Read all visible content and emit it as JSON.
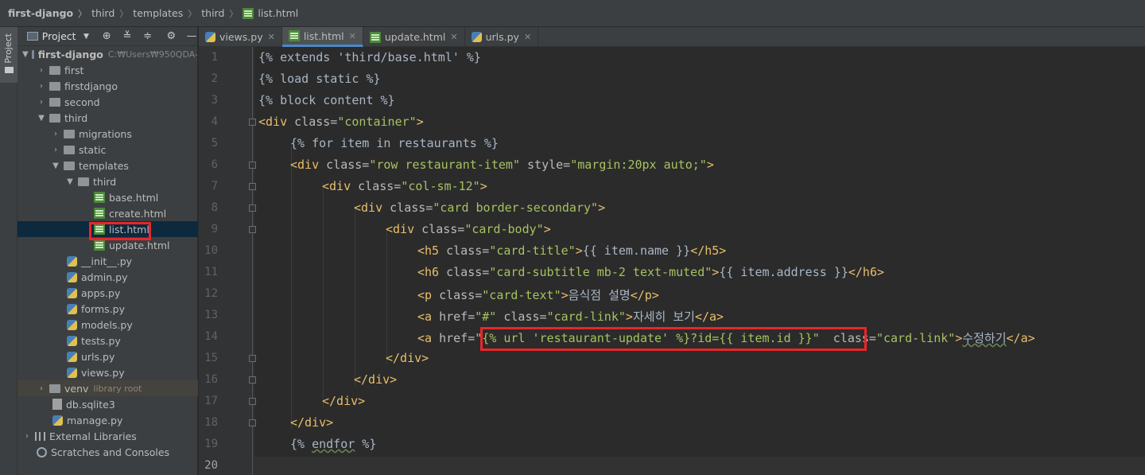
{
  "breadcrumb": {
    "items": [
      "first-django",
      "third",
      "templates",
      "third",
      "list.html"
    ]
  },
  "side_stripe": {
    "tab_label": "Project"
  },
  "project_panel": {
    "title": "Project",
    "tree": [
      {
        "label": "first-django",
        "hint": "C:₩Users₩950QDA-",
        "type": "root",
        "expanded": true
      },
      {
        "label": "first",
        "type": "folder"
      },
      {
        "label": "firstdjango",
        "type": "folder"
      },
      {
        "label": "second",
        "type": "folder"
      },
      {
        "label": "third",
        "type": "folder",
        "expanded": true
      },
      {
        "label": "migrations",
        "type": "folder"
      },
      {
        "label": "static",
        "type": "folder"
      },
      {
        "label": "templates",
        "type": "folder",
        "expanded": true
      },
      {
        "label": "third",
        "type": "folder",
        "expanded": true
      },
      {
        "label": "base.html",
        "type": "html"
      },
      {
        "label": "create.html",
        "type": "html"
      },
      {
        "label": "list.html",
        "type": "html",
        "selected": true
      },
      {
        "label": "update.html",
        "type": "html"
      },
      {
        "label": "__init__.py",
        "type": "py"
      },
      {
        "label": "admin.py",
        "type": "py"
      },
      {
        "label": "apps.py",
        "type": "py"
      },
      {
        "label": "forms.py",
        "type": "py"
      },
      {
        "label": "models.py",
        "type": "py"
      },
      {
        "label": "tests.py",
        "type": "py"
      },
      {
        "label": "urls.py",
        "type": "py"
      },
      {
        "label": "views.py",
        "type": "py"
      },
      {
        "label": "venv",
        "hint": "library root",
        "type": "folder"
      },
      {
        "label": "db.sqlite3",
        "type": "db"
      },
      {
        "label": "manage.py",
        "type": "py"
      },
      {
        "label": "External Libraries",
        "type": "lib"
      },
      {
        "label": "Scratches and Consoles",
        "type": "scratch"
      }
    ]
  },
  "tabs": [
    {
      "label": "views.py",
      "type": "py",
      "active": false
    },
    {
      "label": "list.html",
      "type": "html",
      "active": true
    },
    {
      "label": "update.html",
      "type": "html",
      "active": false
    },
    {
      "label": "urls.py",
      "type": "py",
      "active": false
    }
  ],
  "editor": {
    "line_numbers": [
      "1",
      "2",
      "3",
      "4",
      "5",
      "6",
      "7",
      "8",
      "9",
      "10",
      "11",
      "12",
      "13",
      "14",
      "15",
      "16",
      "17",
      "18",
      "19",
      "20"
    ],
    "lines": {
      "l1": "{% extends 'third/base.html' %}",
      "l2": "{% load static %}",
      "l3": "{% block content %}",
      "l4_tag": "<div",
      "l4_attr": " class=",
      "l4_val": "\"container\"",
      "l4_end": ">",
      "l5": "{% for item in restaurants %}",
      "l6_tag": "<div",
      "l6_attr1": " class=",
      "l6_val1": "\"row restaurant-item\"",
      "l6_attr2": " style=",
      "l6_val2": "\"margin:20px auto;\"",
      "l6_end": ">",
      "l7_tag": "<div",
      "l7_attr": " class=",
      "l7_val": "\"col-sm-12\"",
      "l7_end": ">",
      "l8_tag": "<div",
      "l8_attr": " class=",
      "l8_val": "\"card border-secondary\"",
      "l8_end": ">",
      "l9_tag": "<div",
      "l9_attr": " class=",
      "l9_val": "\"card-body\"",
      "l9_end": ">",
      "l10_tag": "<h5",
      "l10_attr": " class=",
      "l10_val": "\"card-title\"",
      "l10_end": ">",
      "l10_text": "{{ item.name }}",
      "l10_close": "</h5>",
      "l11_tag": "<h6",
      "l11_attr": " class=",
      "l11_val": "\"card-subtitle mb-2 text-muted\"",
      "l11_end": ">",
      "l11_text": "{{ item.address }}",
      "l11_close": "</h6>",
      "l12_tag": "<p",
      "l12_attr": " class=",
      "l12_val": "\"card-text\"",
      "l12_end": ">",
      "l12_text": "음식점 설명",
      "l12_close": "</p>",
      "l13_tag": "<a",
      "l13_attr1": " href=",
      "l13_val1": "\"#\"",
      "l13_attr2": " class=",
      "l13_val2": "\"card-link\"",
      "l13_end": ">",
      "l13_text": "자세히 보기",
      "l13_close": "</a>",
      "l14_tag": "<a",
      "l14_attr1": " href=",
      "l14_val1a": "\"",
      "l14_tmpl": "{% url 'restaurant-update' %}?id={{ item.id }}",
      "l14_val1b": "\"",
      "l14_attr2": " class=",
      "l14_val2": "\"card-link\"",
      "l14_end": ">",
      "l14_text": "수정하기",
      "l14_close": "</a>",
      "l15": "</div>",
      "l16": "</div>",
      "l17": "</div>",
      "l18": "</div>",
      "l19_a": "{% ",
      "l19_b": "endfor",
      "l19_c": " %}"
    }
  },
  "colors": {
    "highlight_box": "#e8262a",
    "tag": "#e8bf6a",
    "attr_value": "#a5c261",
    "selection": "#0d293e"
  }
}
